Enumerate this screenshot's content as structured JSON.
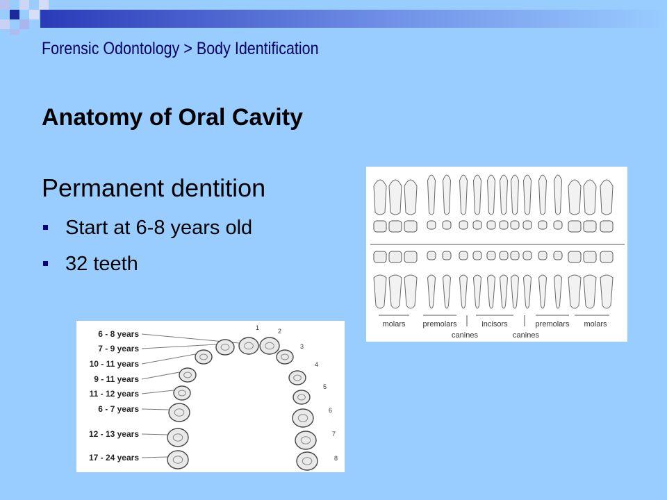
{
  "slide": {
    "breadcrumb": "Forensic Odontology > Body Identification",
    "title": "Anatomy of Oral Cavity",
    "heading": "Permanent dentition",
    "bullets": [
      "Start at 6-8 years old",
      "32 teeth"
    ]
  },
  "tooth_chart": {
    "top_labels": [
      "molars",
      "premolars",
      "incisors",
      "premolars",
      "molars"
    ],
    "bottom_labels": [
      "canines",
      "canines"
    ]
  },
  "eruption_chart": {
    "ages": [
      "6 - 8 years",
      "7 - 9 years",
      "10 - 11 years",
      "9 - 11 years",
      "11 - 12 years",
      "6 - 7 years",
      "12 - 13 years",
      "17 - 24 years"
    ],
    "numbers": [
      "1",
      "2",
      "3",
      "4",
      "5",
      "6",
      "7",
      "8"
    ]
  },
  "colors": {
    "background": "#99ccff",
    "accent": "#000080"
  }
}
